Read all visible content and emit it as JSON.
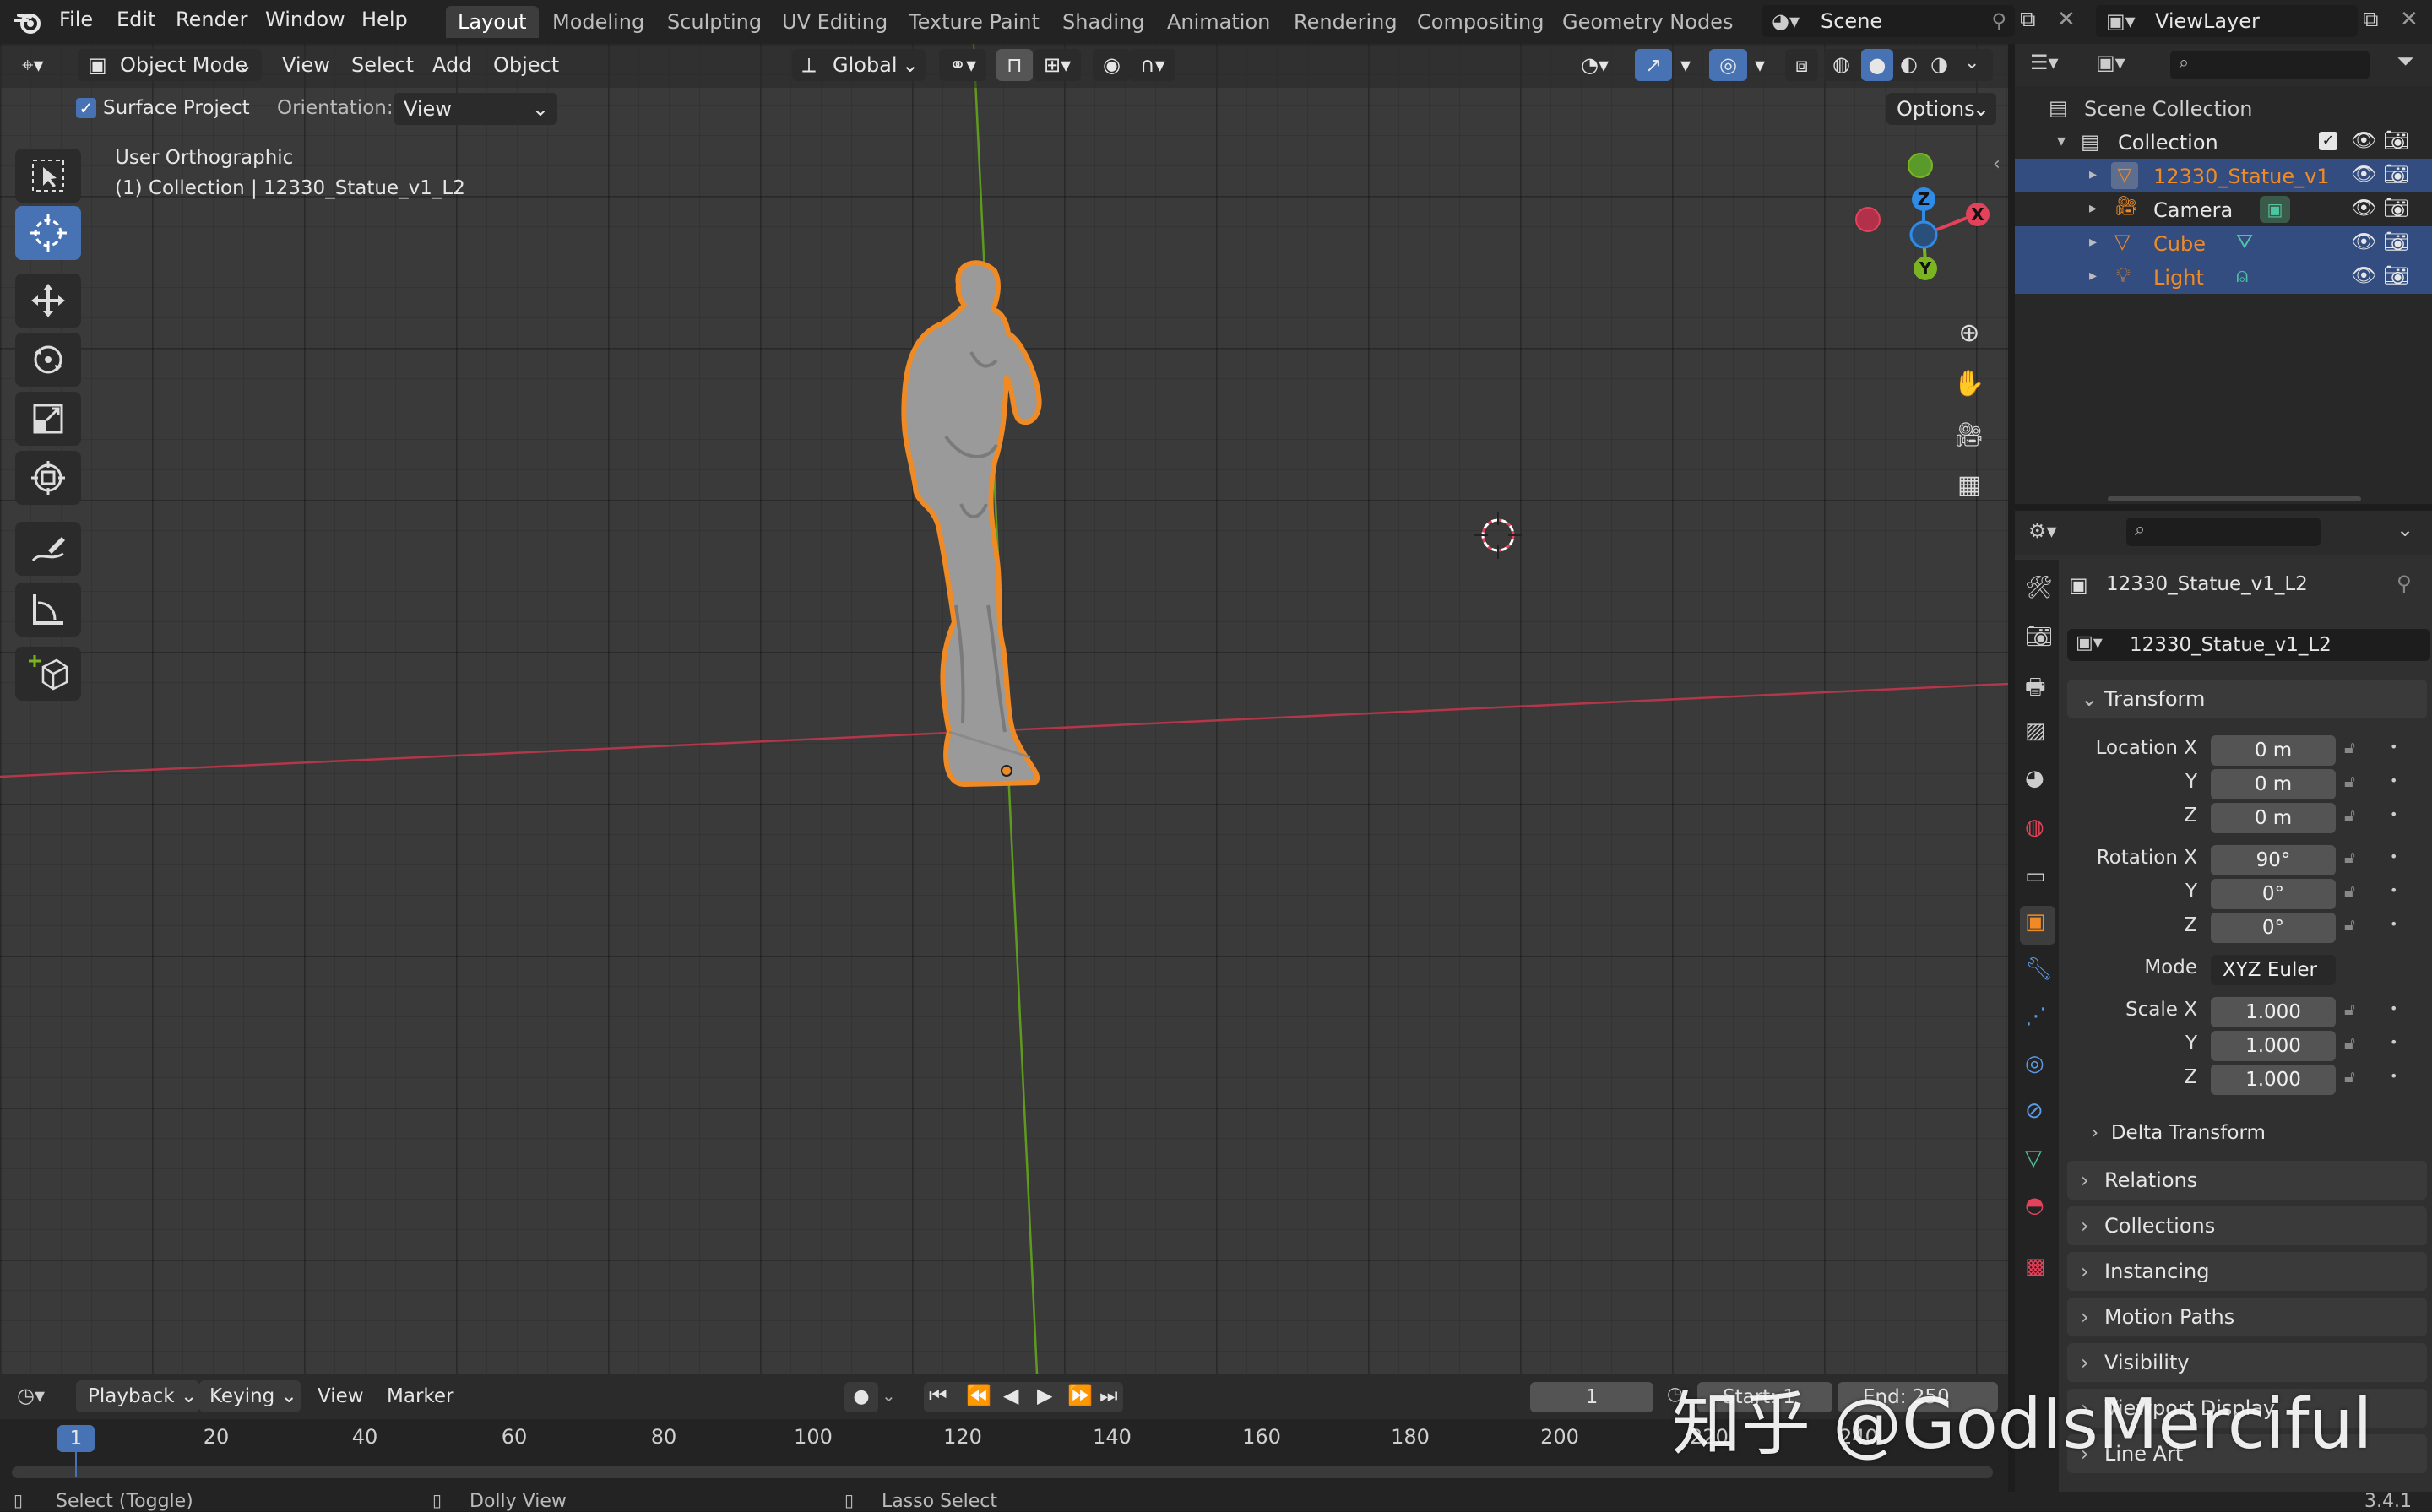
{
  "topbar": {
    "menus": [
      "File",
      "Edit",
      "Render",
      "Window",
      "Help"
    ],
    "workspaces": [
      "Layout",
      "Modeling",
      "Sculpting",
      "UV Editing",
      "Texture Paint",
      "Shading",
      "Animation",
      "Rendering",
      "Compositing",
      "Geometry Nodes"
    ],
    "active_workspace": "Layout",
    "scene": "Scene",
    "view_layer": "ViewLayer"
  },
  "viewport_header": {
    "mode": "Object Mode",
    "menus": [
      "View",
      "Select",
      "Add",
      "Object"
    ],
    "orientation": "Global",
    "surface_project_label": "Surface Project",
    "orientation_label": "Orientation:",
    "orientation_value": "View",
    "options_label": "Options"
  },
  "viewport": {
    "view_name": "User Orthographic",
    "collection_info": "(1) Collection | 12330_Statue_v1_L2",
    "gizmo_axes": [
      "Z",
      "X",
      "Y"
    ]
  },
  "outliner": {
    "root": "Scene Collection",
    "collection": "Collection",
    "items": [
      {
        "name": "12330_Statue_v1",
        "color": "#f08a24"
      },
      {
        "name": "Camera",
        "color": "#e6e6e6"
      },
      {
        "name": "Cube",
        "color": "#f08a24"
      },
      {
        "name": "Light",
        "color": "#f08a24"
      }
    ]
  },
  "properties": {
    "object_name": "12330_Statue_v1_L2",
    "data_name": "12330_Statue_v1_L2",
    "transform_header": "Transform",
    "location_label": "Location X",
    "location": [
      "0 m",
      "0 m",
      "0 m"
    ],
    "rotation_label": "Rotation X",
    "rotation": [
      "90°",
      "0°",
      "0°"
    ],
    "mode_label": "Mode",
    "mode_value": "XYZ Euler",
    "scale_label": "Scale X",
    "scale": [
      "1.000",
      "1.000",
      "1.000"
    ],
    "axis_y": "Y",
    "axis_z": "Z",
    "delta_transform": "Delta Transform",
    "panels": [
      "Relations",
      "Collections",
      "Instancing",
      "Motion Paths",
      "Visibility",
      "Viewport Display",
      "Line Art"
    ]
  },
  "timeline": {
    "menus": [
      "Playback",
      "Keying",
      "View",
      "Marker"
    ],
    "current_frame": "1",
    "start_label": "Start",
    "start_value": "1",
    "end_label": "End",
    "end_value": "250",
    "ticks": [
      "1",
      "20",
      "40",
      "60",
      "80",
      "100",
      "120",
      "140",
      "160",
      "180",
      "200",
      "220",
      "240"
    ]
  },
  "statusbar": {
    "hints": [
      "Select (Toggle)",
      "Dolly View",
      "Lasso Select"
    ],
    "version": "3.4.1"
  },
  "watermark": "知乎 @GodIsMerciful",
  "colors": {
    "accent_blue": "#4772b3",
    "selection_orange": "#f08a24",
    "x_axis": "#e3425a",
    "y_axis": "#7ab521",
    "z_axis": "#2f8be6"
  }
}
